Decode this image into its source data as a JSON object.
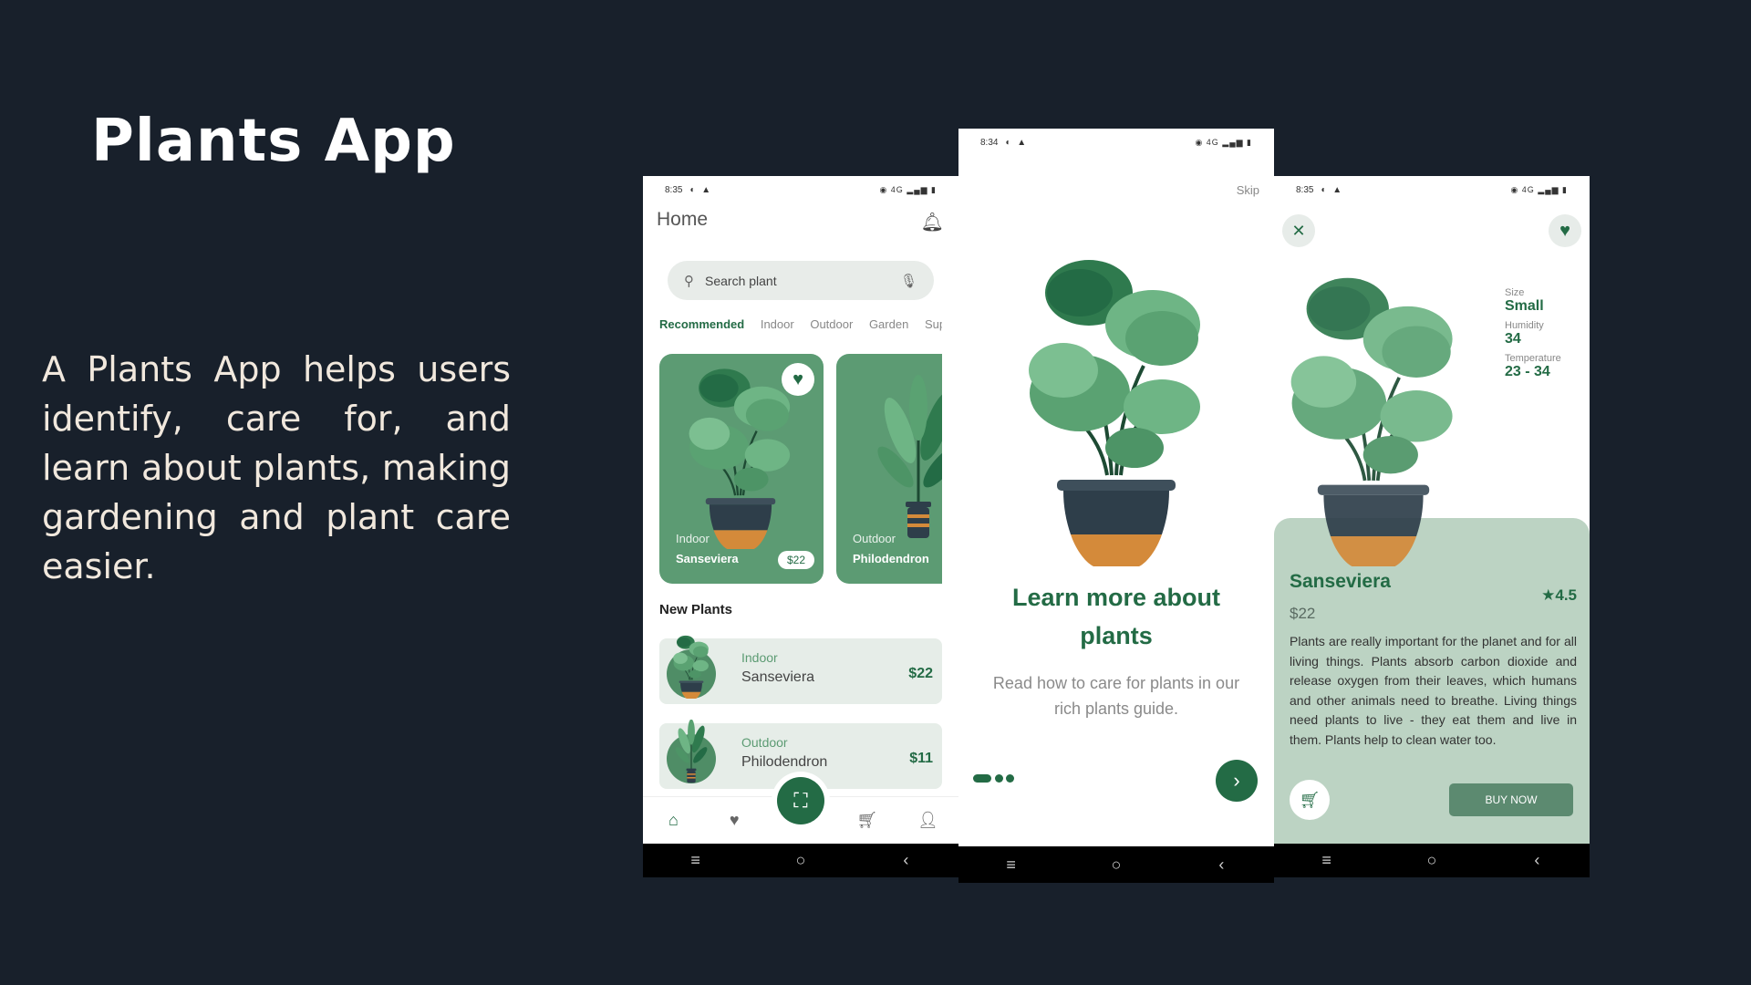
{
  "slide": {
    "title": "Plants App",
    "description": "A Plants App helps users identify, care for, and learn about plants, making gardening and plant care easier."
  },
  "colors": {
    "background": "#18202b",
    "brand_green": "#236b45",
    "card_green": "#5c9b73",
    "panel_green": "#bcd3c3",
    "pot_orange": "#d48a3a",
    "pot_dark": "#2e3e4a"
  },
  "home_screen": {
    "status_time": "8:35",
    "title": "Home",
    "search_placeholder": "Search plant",
    "categories": [
      "Recommended",
      "Indoor",
      "Outdoor",
      "Garden",
      "Supp"
    ],
    "cards": [
      {
        "type": "Indoor",
        "name": "Sanseviera",
        "price": "$22"
      },
      {
        "type": "Outdoor",
        "name": "Philodendron"
      }
    ],
    "section_title": "New Plants",
    "new_plants": [
      {
        "type": "Indoor",
        "name": "Sanseviera",
        "price": "$22"
      },
      {
        "type": "Outdoor",
        "name": "Philodendron",
        "price": "$11"
      }
    ],
    "tab_icons": [
      "home-icon",
      "heart-icon",
      "scan-icon",
      "cart-icon",
      "person-icon"
    ]
  },
  "onboarding_screen": {
    "status_time": "8:34",
    "skip": "Skip",
    "title": "Learn more about plants",
    "text": "Read how to care for plants in our rich plants guide."
  },
  "detail_screen": {
    "status_time": "8:35",
    "specs": [
      {
        "label": "Size",
        "value": "Small"
      },
      {
        "label": "Humidity",
        "value": "34"
      },
      {
        "label": "Temperature",
        "value": "23 - 34"
      }
    ],
    "name": "Sanseviera",
    "rating": "★4.5",
    "price": "$22",
    "description": "Plants are really important for the planet and for all living things. Plants absorb carbon dioxide and release oxygen from their leaves, which humans and other animals need to breathe. Living things need plants to live - they eat them and live in them. Plants help to clean water too.",
    "buy_label": "BUY NOW"
  },
  "system_nav_icons": [
    "menu-icon",
    "home-circle-icon",
    "back-icon"
  ]
}
